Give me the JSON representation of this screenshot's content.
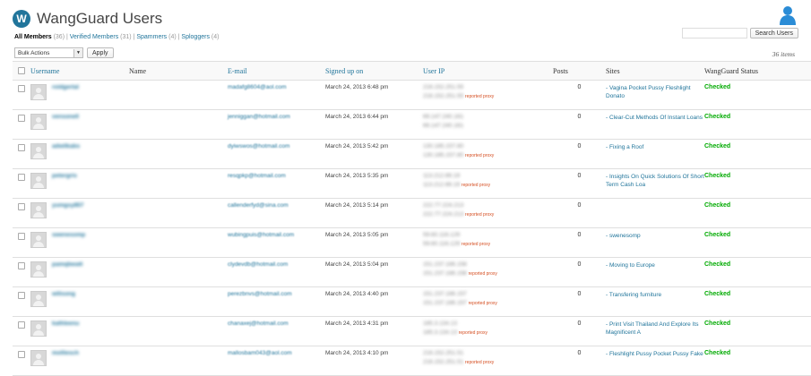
{
  "header": {
    "title": "WangGuard Users",
    "logo_letter": "W",
    "user_icon": "person-icon"
  },
  "search": {
    "placeholder": "",
    "button": "Search Users"
  },
  "filters": {
    "all": "All Members",
    "all_count": "(36)",
    "verified": "Verified Members",
    "verified_count": "(31)",
    "spammers": "Spammers",
    "spammers_count": "(4)",
    "sploggers": "Sploggers",
    "sploggers_count": "(4)"
  },
  "bulk": {
    "selected": "Bulk Actions",
    "apply": "Apply"
  },
  "items_count": "36 items",
  "columns": {
    "username": "Username",
    "name": "Name",
    "email": "E-mail",
    "signed_up": "Signed up on",
    "user_ip": "User IP",
    "posts": "Posts",
    "sites": "Sites",
    "status": "WangGuard Status"
  },
  "proxy_label": "reported proxy",
  "rows": [
    {
      "username": "roidgertal",
      "email": "madafg8604@aol.com",
      "date": "March 24, 2013 6:48 pm",
      "ip1": "216.152.251.55",
      "ip2": "216.152.251.55",
      "ip2_proxy": true,
      "posts": "0",
      "site": "- Vagina Pocket Pussy Fleshlight Donato",
      "status": "Checked"
    },
    {
      "username": "vensonell",
      "email": "jenniggan@hotmail.com",
      "date": "March 24, 2013 6:44 pm",
      "ip1": "69.147.240.161",
      "ip2": "69.147.240.161",
      "ip2_proxy": false,
      "posts": "0",
      "site": "- Clear-Cut Methods Of Instant Loans",
      "status": "Checked"
    },
    {
      "username": "adwilkabs",
      "email": "dyiwswos@hotmail.com",
      "date": "March 24, 2013 5:42 pm",
      "ip1": "130.185.157.80",
      "ip2": "130.185.157.80",
      "ip2_proxy": true,
      "posts": "0",
      "site": "- Fixing a Roof",
      "status": "Checked"
    },
    {
      "username": "petergris",
      "email": "resqpkp@hotmail.com",
      "date": "March 24, 2013 5:35 pm",
      "ip1": "113.212.69.19",
      "ip2": "113.212.69.19",
      "ip2_proxy": true,
      "posts": "0",
      "site": "- Insights On Quick Solutions Of Short Term Cash Loa",
      "status": "Checked"
    },
    {
      "username": "yumgsy857",
      "email": "callenderfyd@sina.com",
      "date": "March 24, 2013 5:14 pm",
      "ip1": "222.77.224.213",
      "ip2": "222.77.224.213",
      "ip2_proxy": true,
      "posts": "0",
      "site": "",
      "status": "Checked"
    },
    {
      "username": "swenesomp",
      "email": "wubingpuis@hotmail.com",
      "date": "March 24, 2013 5:05 pm",
      "ip1": "59.60.116.129",
      "ip2": "59.60.116.129",
      "ip2_proxy": true,
      "posts": "0",
      "site": "- swenesomp",
      "status": "Checked"
    },
    {
      "username": "pamqbwatt",
      "email": "clydevdb@hotmail.com",
      "date": "March 24, 2013 5:04 pm",
      "ip1": "151.237.186.158",
      "ip2": "151.237.186.158",
      "ip2_proxy": true,
      "posts": "0",
      "site": "- Moving to Europe",
      "status": "Checked"
    },
    {
      "username": "wilisong",
      "email": "perezbnvs@hotmail.com",
      "date": "March 24, 2013 4:40 pm",
      "ip1": "151.237.186.157",
      "ip2": "151.237.186.157",
      "ip2_proxy": true,
      "posts": "0",
      "site": "- Transfering furniture",
      "status": "Checked"
    },
    {
      "username": "kathleenu",
      "email": "chanaxej@hotmail.com",
      "date": "March 24, 2013 4:31 pm",
      "ip1": "185.3.134.13",
      "ip2": "185.3.134.13",
      "ip2_proxy": true,
      "posts": "0",
      "site": "- Print Visit Thailand And Explore Its Magnificent A",
      "status": "Checked"
    },
    {
      "username": "molliesch",
      "email": "mallosbam043@aol.com",
      "date": "March 24, 2013 4:10 pm",
      "ip1": "216.152.251.51",
      "ip2": "216.152.251.51",
      "ip2_proxy": true,
      "posts": "0",
      "site": "- Fleshlight Pussy Pocket Pussy Fake",
      "status": "Checked"
    }
  ]
}
